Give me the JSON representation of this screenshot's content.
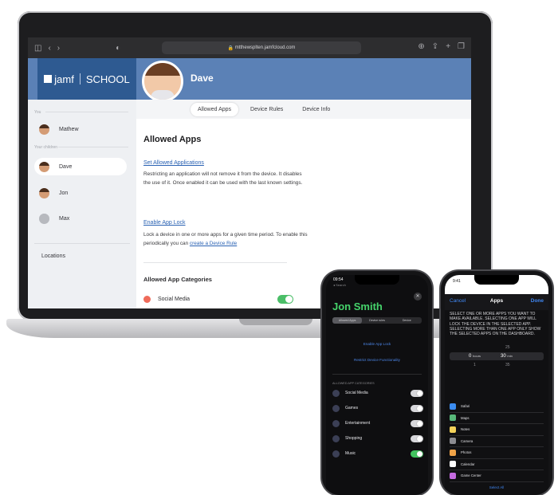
{
  "browser": {
    "url": "mtthewsplten.jamfcloud.com"
  },
  "brand": {
    "name": "jamf",
    "product": "SCHOOL"
  },
  "student": {
    "name": "Dave"
  },
  "tabs": [
    {
      "label": "Allowed Apps",
      "active": true
    },
    {
      "label": "Device Rules",
      "active": false
    },
    {
      "label": "Device Info",
      "active": false
    }
  ],
  "sidebar": {
    "section_you": "You",
    "section_children": "Your children",
    "items": [
      {
        "label": "Mathew",
        "active": false
      },
      {
        "label": "Dave",
        "active": true
      },
      {
        "label": "Jon",
        "active": false
      },
      {
        "label": "Max",
        "active": false
      }
    ],
    "locations": "Locations"
  },
  "main": {
    "title": "Allowed Apps",
    "set_allowed_link": "Set Allowed Applications",
    "set_allowed_text": "Restricting an application will not remove it from the device. It disables the use of it. Once enabled it can be used with the last known settings.",
    "app_lock_link": "Enable App Lock",
    "app_lock_text": "Lock a device in one or more apps for a given time period. To enable this periodically you can",
    "app_lock_rule_link": "create a Device Rule",
    "categories_title": "Allowed App Categories",
    "categories": [
      {
        "label": "Social Media",
        "enabled": true
      }
    ]
  },
  "phone1": {
    "time": "09:54",
    "back": "◂ Search",
    "student_name": "Jon Smith",
    "segments": [
      {
        "label": "Allowed Apps",
        "active": true
      },
      {
        "label": "Device rules",
        "active": false
      },
      {
        "label": "Device",
        "active": false
      }
    ],
    "enable_app_lock": "Enable App Lock",
    "restrict_device": "Restrict Device Functionality",
    "categories_title": "ALLOWED APP CATEGORIES",
    "categories": [
      {
        "label": "Social Media",
        "enabled": false
      },
      {
        "label": "Games",
        "enabled": false
      },
      {
        "label": "Entertainment",
        "enabled": false
      },
      {
        "label": "Shopping",
        "enabled": false
      },
      {
        "label": "Music",
        "enabled": true
      }
    ]
  },
  "phone2": {
    "time": "9:41",
    "cancel": "Cancel",
    "title": "Apps",
    "done": "Done",
    "instructions": "SELECT ONE OR MORE APPS YOU WANT TO MAKE AVAILABLE. SELECTING ONE APP WILL LOCK THE DEVICE IN THE SELECTED APP. SELECTING MORE THAN ONE APP ONLY SHOW THE SELECTED APPS ON THE DASHBOARD.",
    "picker": {
      "hours_above": "",
      "minutes_above": "25",
      "hours_value": "0",
      "hours_unit": "hours",
      "minutes_value": "30",
      "minutes_unit": "min",
      "hours_below": "1",
      "minutes_below": "35"
    },
    "apps": [
      {
        "label": "Safari",
        "color": "#3b8cf0"
      },
      {
        "label": "Maps",
        "color": "#58b87a"
      },
      {
        "label": "Notes",
        "color": "#f3d25a"
      },
      {
        "label": "Camera",
        "color": "#8b8b90"
      },
      {
        "label": "Photos",
        "color": "#f0a348"
      },
      {
        "label": "Calendar",
        "color": "#ffffff"
      },
      {
        "label": "Game Center",
        "color": "#c46adf"
      }
    ],
    "select_all": "Select All"
  },
  "colors": {
    "header_blue": "#5b81b6",
    "brand_blue": "#2e5a91",
    "link_blue": "#2a62b3",
    "toggle_green": "#4bbe68",
    "phone_name_green": "#45d36b"
  }
}
